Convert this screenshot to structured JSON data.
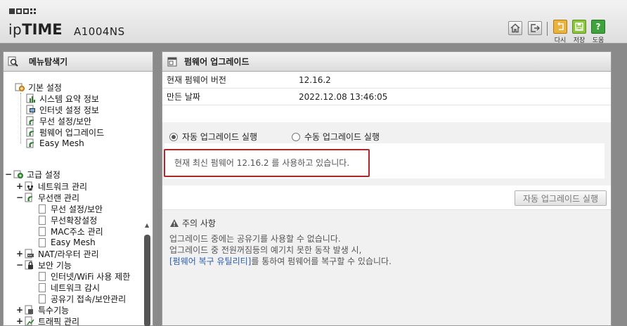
{
  "header": {
    "brand_prefix": "ip",
    "brand_bold": "TIME",
    "model": "A1004NS",
    "buttons": {
      "retry_label": "다시",
      "save_label": "저장",
      "help_label": "도움"
    }
  },
  "nav": {
    "title": "메뉴탐색기",
    "groups": [
      {
        "label": "기본 설정",
        "items": [
          "시스템 요약 정보",
          "인터넷 설정 정보",
          "무선 설정/보안",
          "펌웨어 업그레이드",
          "Easy Mesh"
        ]
      },
      {
        "label": "고급 설정",
        "sections": [
          {
            "label": "네트워크 관리",
            "expander": "+"
          },
          {
            "label": "무선랜 관리",
            "expander": "−",
            "items": [
              "무선 설정/보안",
              "무선확장설정",
              "MAC주소 관리",
              "Easy Mesh"
            ]
          },
          {
            "label": "NAT/라우터 관리",
            "expander": "+"
          },
          {
            "label": "보안 기능",
            "expander": "−",
            "items": [
              "인터넷/WiFi 사용 제한",
              "네트워크 감시",
              "공유기 접속/보안관리"
            ]
          },
          {
            "label": "특수기능",
            "expander": "+"
          },
          {
            "label": "트래픽 관리",
            "expander": "+"
          }
        ]
      }
    ]
  },
  "main": {
    "title": "펌웨어 업그레이드",
    "current_version_label": "현재 펌웨어 버전",
    "current_version": "12.16.2",
    "build_date_label": "만든 날짜",
    "build_date": "2022.12.08 13:46:05",
    "options": {
      "auto_label": "자동 업그레이드 실행",
      "manual_label": "수동 업그레이드 실행",
      "selected": "auto"
    },
    "status_message": "현재 최신 펌웨어 12.16.2 를 사용하고 있습니다.",
    "run_button_label": "자동 업그레이드 실행",
    "caution": {
      "title": "주의 사항",
      "line1": "업그레이드 중에는 공유기를 사용할 수 없습니다.",
      "line2": "업그레이드 중 전원꺼짐등의 예기치 못한 동작 발생 시,",
      "line3_link": "[펌웨어 복구 유틸리티]",
      "line3_rest": "를 통하여 펌웨어를 복구할 수 있습니다."
    }
  },
  "colors": {
    "highlight_border": "#b0272a",
    "link": "#2a5db0",
    "retry": "#eab33d",
    "save": "#8cc43e",
    "help": "#3fa33c"
  }
}
